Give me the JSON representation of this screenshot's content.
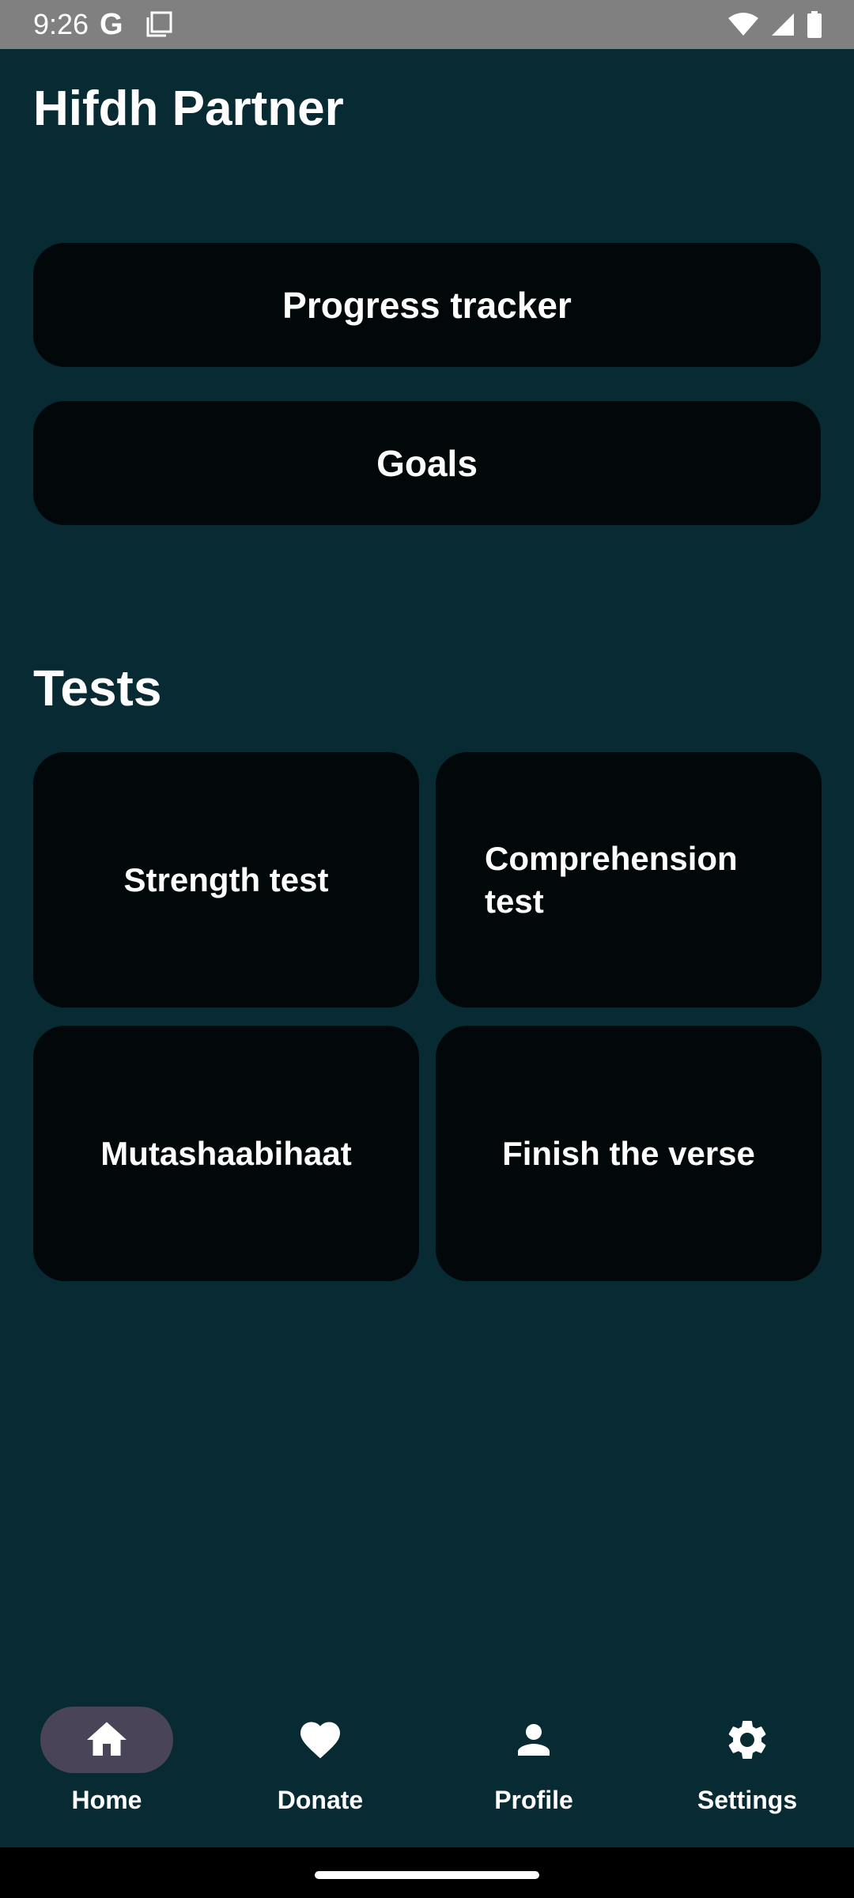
{
  "status_bar": {
    "time": "9:26",
    "g_label": "G",
    "icons": [
      "wifi-icon",
      "signal-icon",
      "battery-icon"
    ]
  },
  "app": {
    "title": "Hifdh Partner"
  },
  "main_buttons": {
    "progress_tracker": "Progress tracker",
    "goals": "Goals"
  },
  "tests": {
    "heading": "Tests",
    "cards": [
      "Strength test",
      "Comprehension test",
      "Mutashaabihaat",
      "Finish the verse"
    ]
  },
  "bottom_nav": {
    "items": [
      {
        "label": "Home",
        "icon": "home-icon",
        "active": true
      },
      {
        "label": "Donate",
        "icon": "heart-icon",
        "active": false
      },
      {
        "label": "Profile",
        "icon": "person-icon",
        "active": false
      },
      {
        "label": "Settings",
        "icon": "gear-icon",
        "active": false
      }
    ]
  },
  "colors": {
    "background": "#072a33",
    "card": "#020809",
    "status_bar": "#808080",
    "nav_active_pill": "#4a4458",
    "text": "#ffffff"
  }
}
